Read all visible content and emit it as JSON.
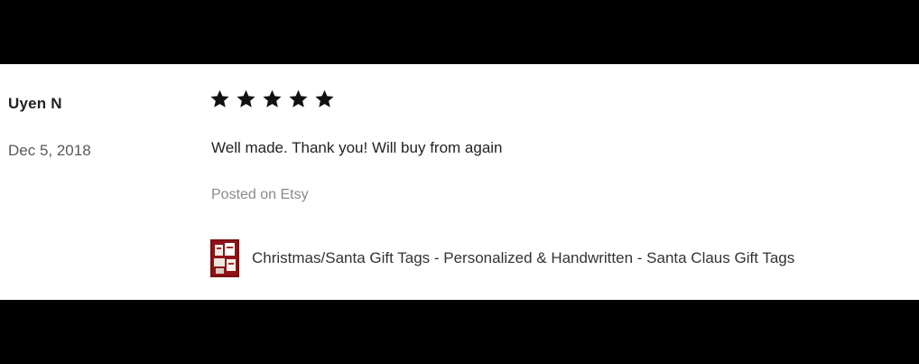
{
  "review": {
    "reviewer_name": "Uyen N",
    "date": "Dec 5, 2018",
    "rating": 5,
    "rating_max": 5,
    "text": "Well made. Thank you! Will buy from again",
    "source": "Posted on Etsy"
  },
  "listing": {
    "title": "Christmas/Santa Gift Tags - Personalized & Handwritten - Santa Claus Gift Tags",
    "thumbnail_icon": "gift-tags-product-photo"
  },
  "colors": {
    "background_bars": "#000000",
    "card": "#ffffff",
    "star": "#111111",
    "thumbnail": "#7a0c10"
  }
}
